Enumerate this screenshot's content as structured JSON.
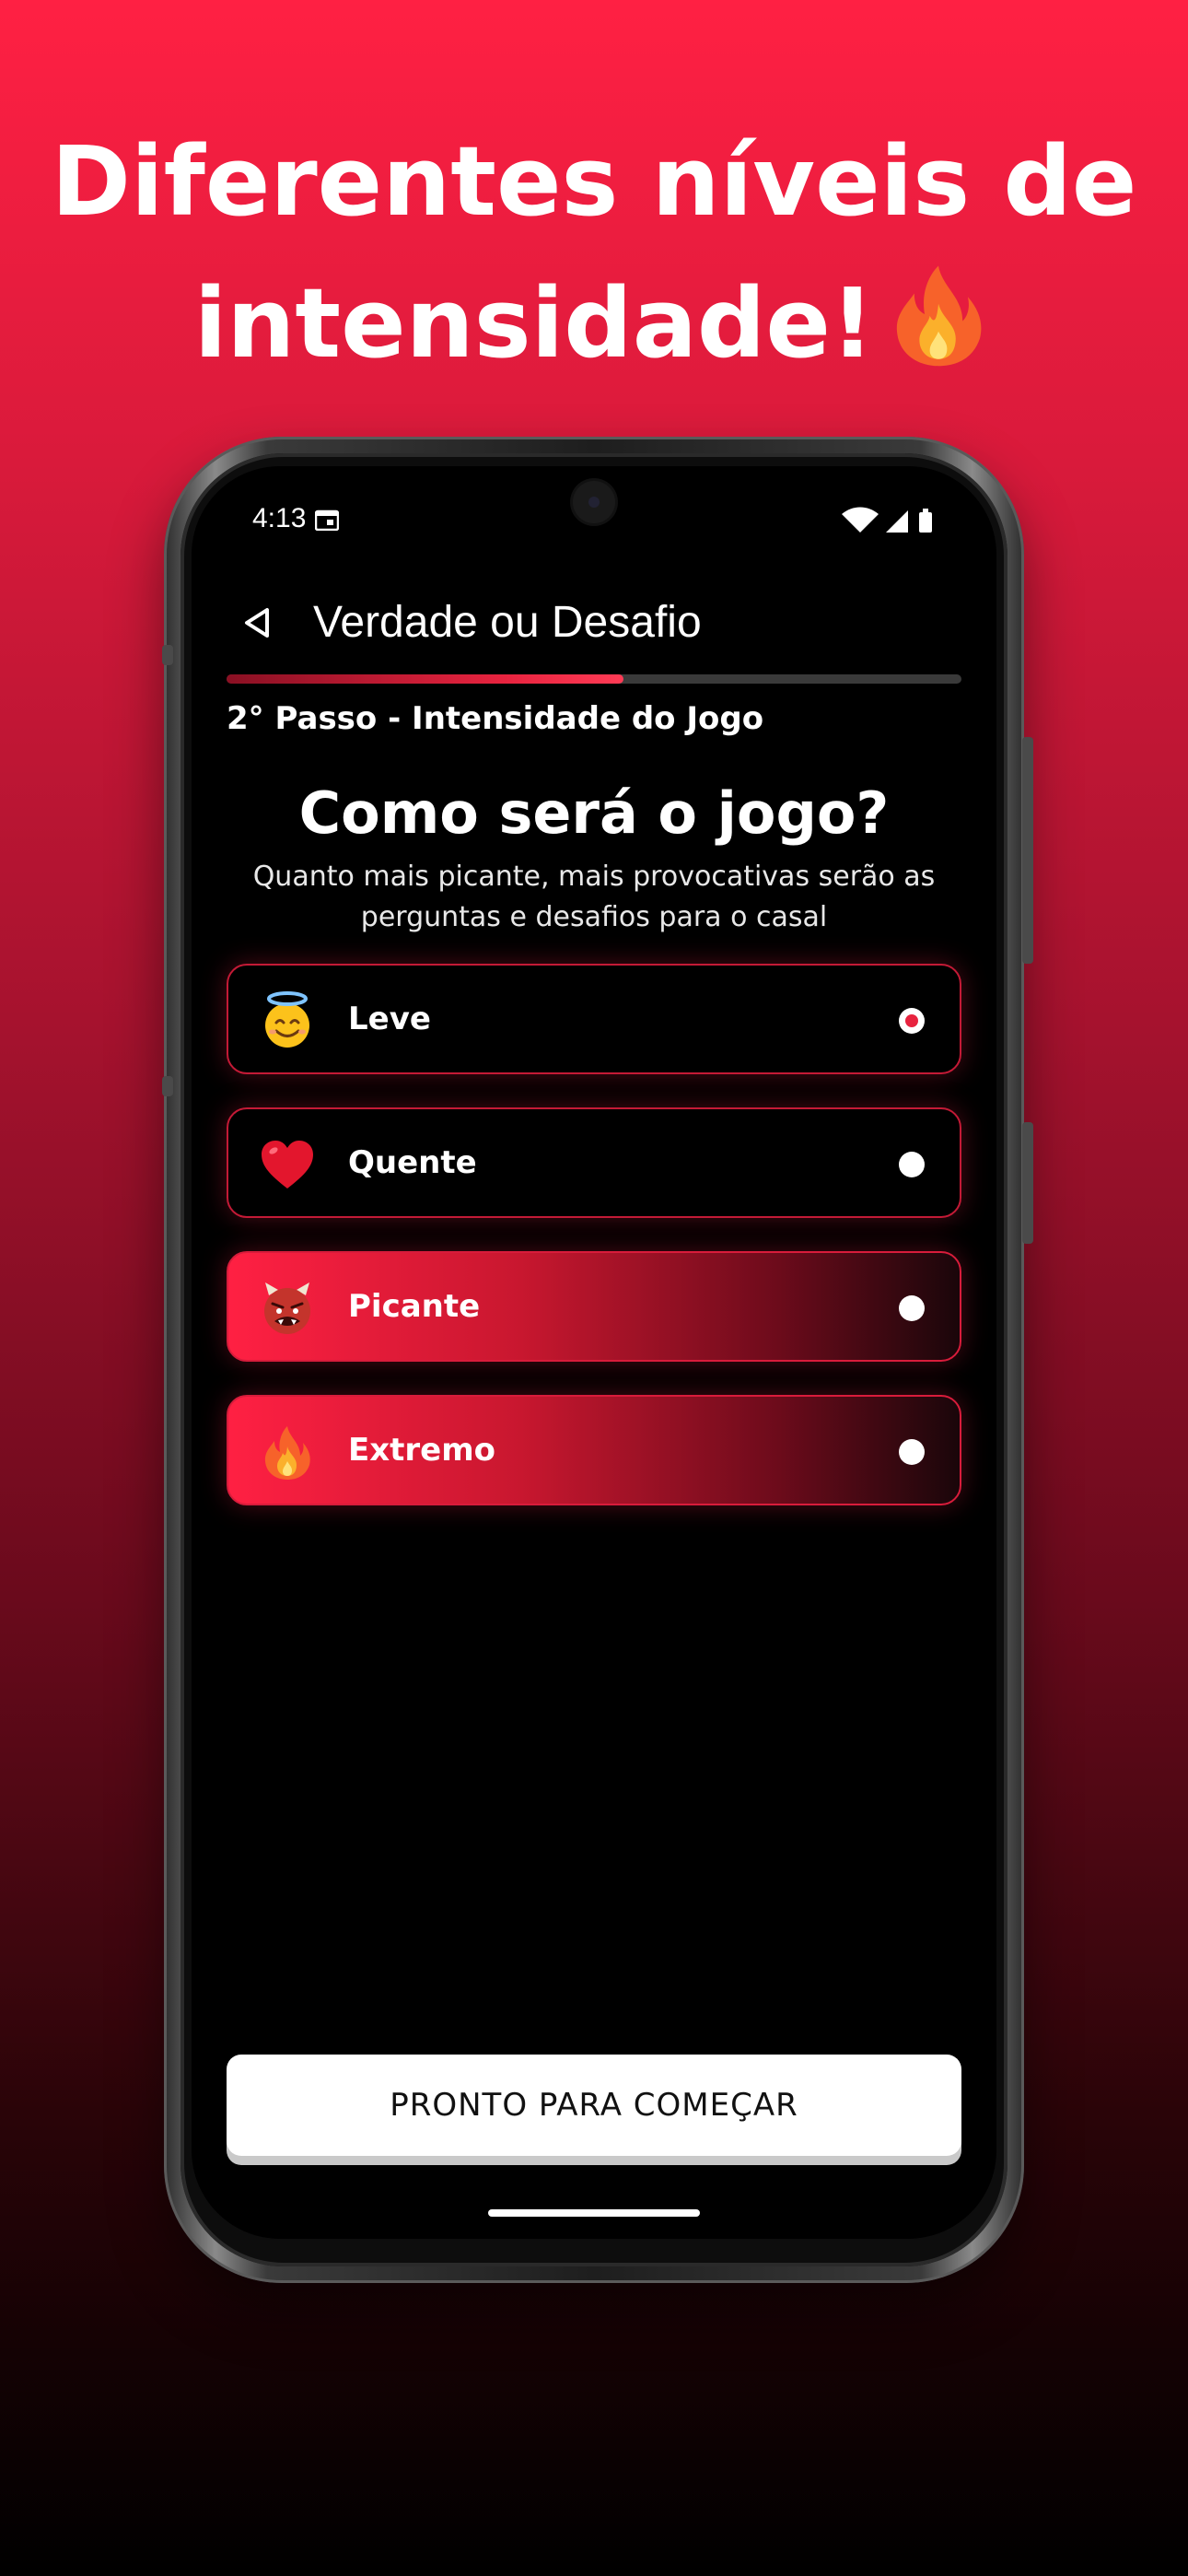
{
  "headline": {
    "line1": "Diferentes níveis de",
    "line2": "intensidade!",
    "emoji_icon": "fire-icon"
  },
  "status_bar": {
    "time": "4:13"
  },
  "app_bar": {
    "title": "Verdade ou Desafio"
  },
  "progress": {
    "fraction": 0.54
  },
  "step_label": "2° Passo - Intensidade do Jogo",
  "question": "Como será o jogo?",
  "subtitle": "Quanto mais picante, mais provocativas serão as perguntas e desafios para o casal",
  "options": [
    {
      "label": "Leve",
      "icon": "smiling-face-with-halo-icon",
      "selected": true
    },
    {
      "label": "Quente",
      "icon": "red-heart-icon",
      "selected": false
    },
    {
      "label": "Picante",
      "icon": "ogre-icon",
      "selected": false
    },
    {
      "label": "Extremo",
      "icon": "fire-icon",
      "selected": false
    }
  ],
  "cta_label": "PRONTO PARA COMEÇAR",
  "colors": {
    "accent": "#e8233f",
    "background_top": "#ff2043",
    "screen": "#000000"
  }
}
